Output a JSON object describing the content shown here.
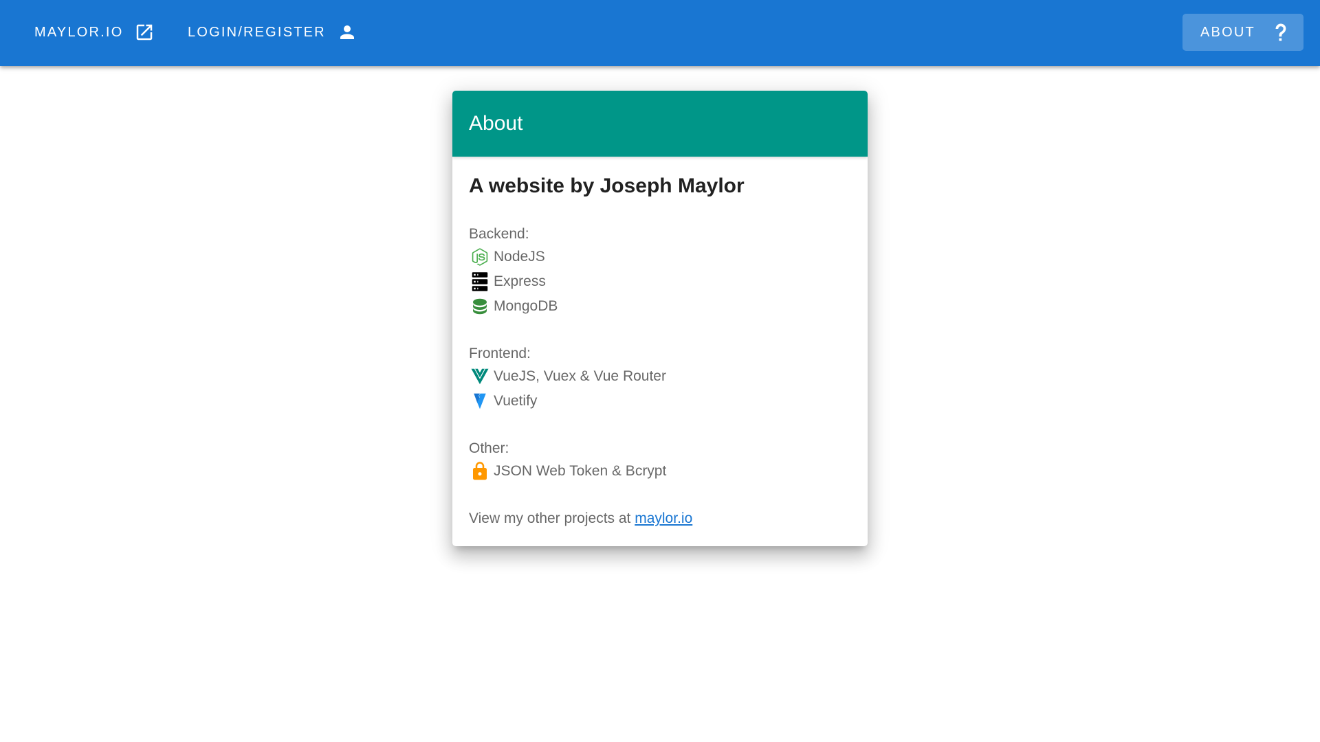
{
  "appbar": {
    "maylor_label": "MAYLOR.IO",
    "login_label": "LOGIN/REGISTER",
    "about_label": "ABOUT"
  },
  "card": {
    "header": "About",
    "title": "A website by Joseph Maylor",
    "backend_label": "Backend:",
    "backend_items": [
      "NodeJS",
      "Express",
      "MongoDB"
    ],
    "frontend_label": "Frontend:",
    "frontend_items": [
      "VueJS, Vuex & Vue Router",
      "Vuetify"
    ],
    "other_label": "Other:",
    "other_items": [
      "JSON Web Token & Bcrypt"
    ],
    "footer_prefix": "View my other projects at ",
    "footer_link": "maylor.io"
  },
  "colors": {
    "appbar": "#1976d2",
    "card_header": "#009688",
    "link": "#1976d2",
    "node_green": "#4caf50",
    "mongo_green": "#388e3c",
    "vue_teal": "#00897b",
    "vuetify_blue": "#2196f3",
    "lock_orange": "#ff9800"
  },
  "icons": {
    "maylor": "open-in-new-icon",
    "login": "account-icon",
    "about": "question-mark-icon",
    "nodejs": "nodejs-icon",
    "express": "server-icon",
    "mongodb": "database-icon",
    "vue": "vuejs-icon",
    "vuetify": "vuetify-icon",
    "jwt": "lock-icon"
  }
}
